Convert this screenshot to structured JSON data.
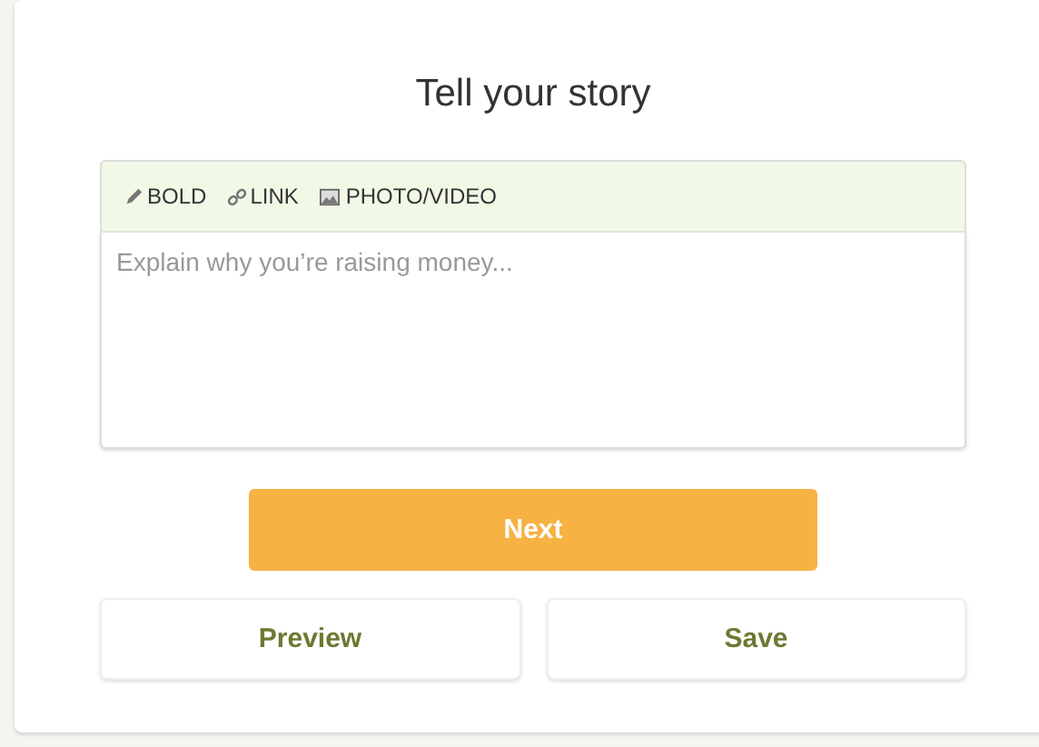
{
  "title": "Tell your story",
  "toolbar": [
    {
      "kind": "bold",
      "label": "BOLD"
    },
    {
      "kind": "link",
      "label": "LINK"
    },
    {
      "kind": "media",
      "label": "PHOTO/VIDEO"
    }
  ],
  "editor": {
    "placeholder": "Explain why you’re raising money..."
  },
  "primary_button": "Next",
  "secondary_buttons": [
    "Preview",
    "Save"
  ]
}
